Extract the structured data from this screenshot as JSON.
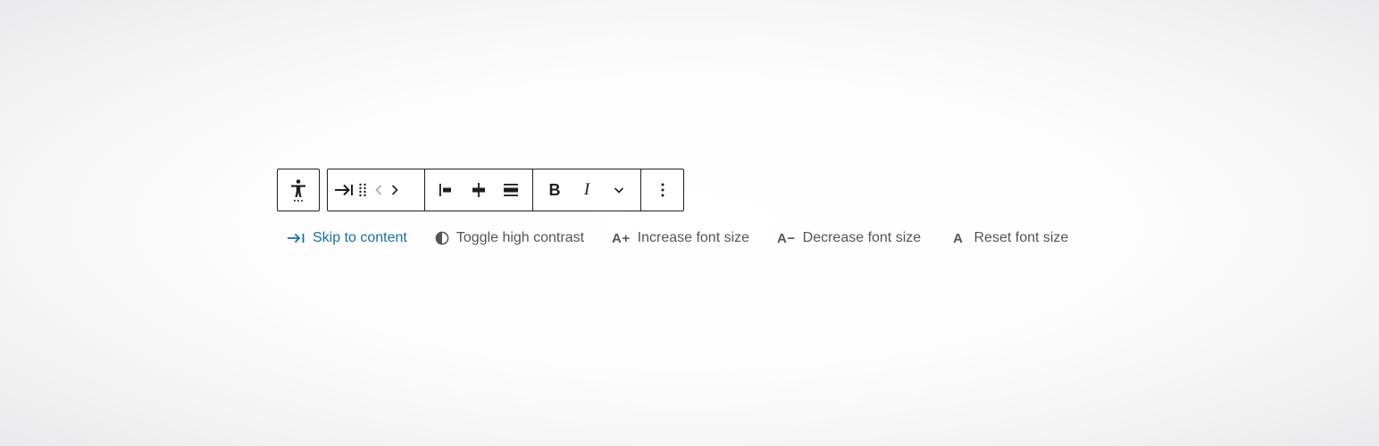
{
  "toolbar": {
    "accessibility_button": "accessibility-menu",
    "block_group": [
      {
        "name": "skip-arrow",
        "icon": "arrow-right-bar-icon"
      },
      {
        "name": "drag-handle",
        "icon": "drag-dots-icon"
      },
      {
        "name": "move-left",
        "icon": "chevron-left-icon"
      },
      {
        "name": "move-right",
        "icon": "chevron-right-icon"
      }
    ],
    "align_group": [
      {
        "name": "align-left",
        "icon": "align-left-icon"
      },
      {
        "name": "align-center",
        "icon": "align-center-icon"
      },
      {
        "name": "align-wide",
        "icon": "align-wide-icon"
      }
    ],
    "format_group": {
      "bold_label": "B",
      "italic_label": "I",
      "more_icon": "chevron-down-icon"
    },
    "options_icon": "more-vertical-icon",
    "colors": {
      "border": "#1e1e1e",
      "icon": "#1e1e1e",
      "disabled_icon": "#a7a7a7"
    }
  },
  "links": {
    "skip": {
      "label": "Skip to content",
      "icon": "arrow-right-bar-icon",
      "color": "#1a6ea8"
    },
    "contrast": {
      "label": "Toggle high contrast",
      "icon": "half-circle-icon"
    },
    "increase": {
      "label": "Increase font size",
      "icon_text": "A+"
    },
    "decrease": {
      "label": "Decrease font size",
      "icon_text": "A−"
    },
    "reset": {
      "label": "Reset font size",
      "icon_text": "A"
    },
    "text_color": "#555555"
  }
}
